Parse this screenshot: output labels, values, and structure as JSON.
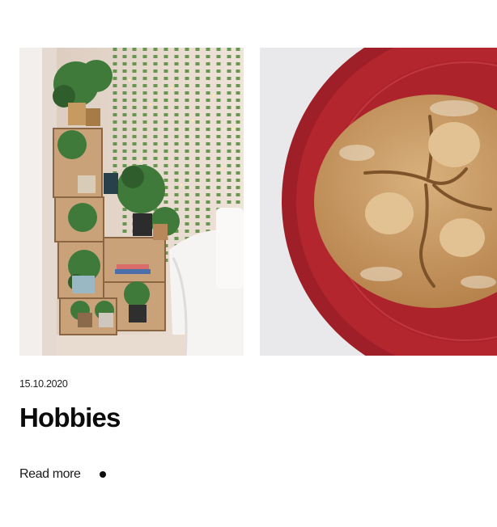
{
  "post": {
    "date": "15.10.2020",
    "title": "Hobbies",
    "read_more_label": "Read more"
  },
  "gallery": {
    "images": [
      {
        "icon": "plant-shelf-photo"
      },
      {
        "icon": "bread-loaf-photo"
      }
    ]
  },
  "colors": {
    "text": "#111111",
    "background": "#ffffff",
    "plate_red": "#b3262e",
    "bread": "#c99a64",
    "leaf_green": "#3f7a3a"
  }
}
